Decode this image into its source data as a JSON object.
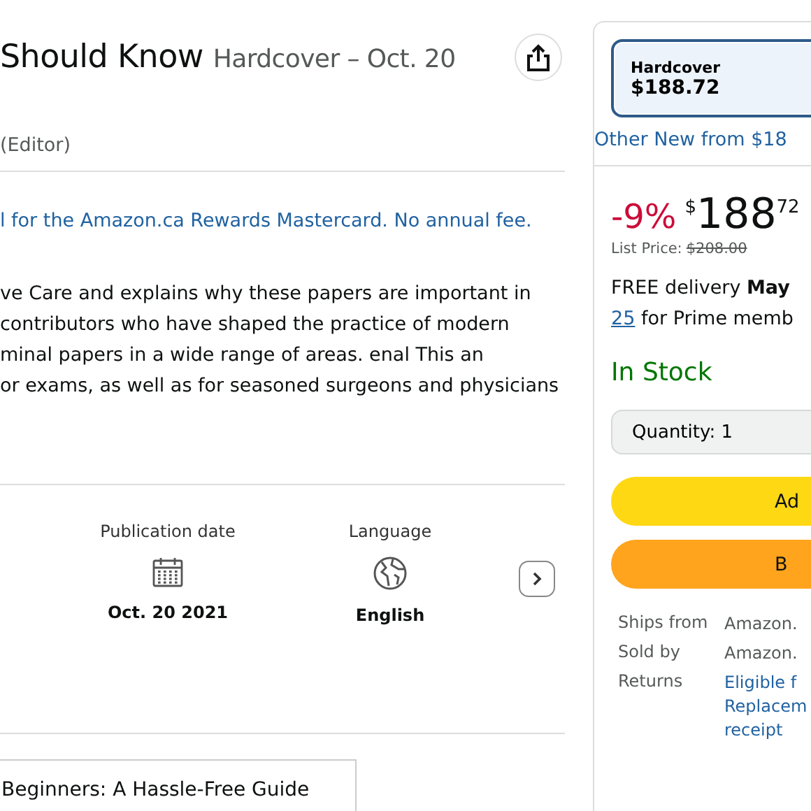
{
  "title": {
    "main": "Should Know",
    "format": "Hardcover – Oct. 20"
  },
  "byline": "(Editor)",
  "promo_link": "l for the Amazon.ca Rewards Mastercard. No annual fee.",
  "description": [
    "ve Care and explains why these papers are important in",
    "contributors who have shaped the practice of modern",
    "minal papers in a wide range of areas. enal This an",
    "or exams, as well as for seasoned surgeons and physicians"
  ],
  "details": [
    {
      "kind": "calendar",
      "label": "Publication date",
      "value": "Oct. 20 2021"
    },
    {
      "kind": "globe",
      "label": "Language",
      "value": "English"
    }
  ],
  "related_card": {
    "title": "Beginners: A Hassle-Free Guide"
  },
  "buy_box": {
    "formats": [
      {
        "name": "Hardcover",
        "price": "$188.72",
        "selected": true
      }
    ],
    "other_new": "Other New from $18",
    "discount": "-9%",
    "currency": "$",
    "price_whole": "188",
    "price_fraction": "72",
    "list_price_label": "List Price:",
    "list_price": "$208.00",
    "delivery": [
      "FREE delivery ",
      "May"
    ],
    "delivery_date_link": "25",
    "delivery_rest": " for Prime memb",
    "stock": "In Stock",
    "quantity": "Quantity: 1",
    "buttons": [
      {
        "kind": "cart",
        "label": "Ad"
      },
      {
        "kind": "buy",
        "label": "B"
      }
    ],
    "info": [
      {
        "label": "Ships from",
        "lines": [
          "Amazon."
        ],
        "link": false
      },
      {
        "label": "Sold by",
        "lines": [
          "Amazon."
        ],
        "link": false
      },
      {
        "label": "Returns",
        "lines": [
          "Eligible f",
          "Replacem",
          "receipt"
        ],
        "link": true
      }
    ]
  }
}
